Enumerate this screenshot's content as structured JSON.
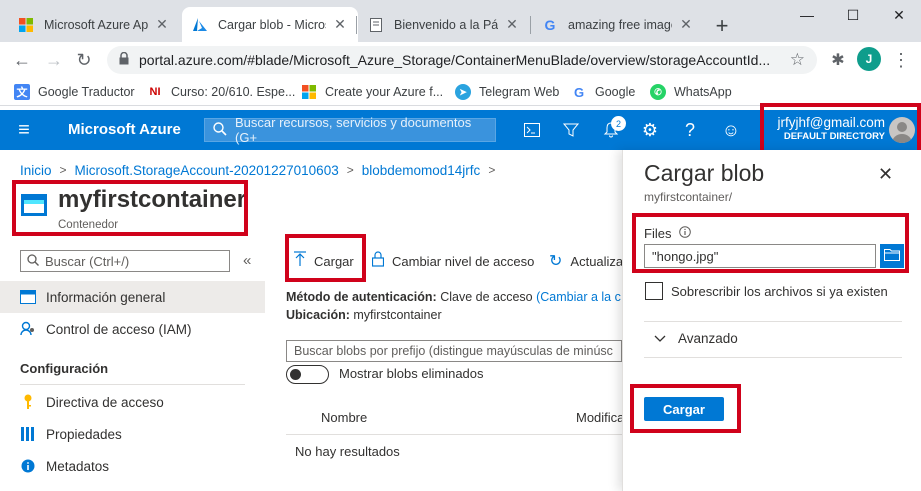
{
  "browser": {
    "tabs": [
      {
        "title": "Microsoft Azure App",
        "active": false
      },
      {
        "title": "Cargar blob - Micros",
        "active": true
      },
      {
        "title": "Bienvenido a la Pági",
        "active": false
      },
      {
        "title": "amazing free image",
        "active": false
      }
    ],
    "new_tab": "+",
    "url": "portal.azure.com/#blade/Microsoft_Azure_Storage/ContainerMenuBlade/overview/storageAccountId...",
    "profile_initial": "J",
    "bookmarks": [
      {
        "label": "Google Traductor",
        "icon": "google-translate-icon"
      },
      {
        "label": "Curso: 20/610. Espe...",
        "icon": "ni-icon"
      },
      {
        "label": "Create your Azure f...",
        "icon": "microsoft-icon"
      },
      {
        "label": "Telegram Web",
        "icon": "telegram-icon"
      },
      {
        "label": "Google",
        "icon": "google-icon"
      },
      {
        "label": "WhatsApp",
        "icon": "whatsapp-icon"
      }
    ]
  },
  "azure": {
    "brand": "Microsoft Azure",
    "search_placeholder": "Buscar recursos, servicios y documentos (G+",
    "notification_count": "2",
    "account_email": "jrfyjhf@gmail.com",
    "account_directory": "DEFAULT DIRECTORY"
  },
  "breadcrumb": [
    "Inicio",
    "Microsoft.StorageAccount-20201227010603",
    "blobdemomod14jrfc"
  ],
  "resource": {
    "title": "myfirstcontainer",
    "subtitle": "Contenedor"
  },
  "leftnav": {
    "search_placeholder": "Buscar (Ctrl+/)",
    "collapse": "«",
    "items": [
      {
        "label": "Información general",
        "icon": "overview-icon"
      },
      {
        "label": "Control de acceso (IAM)",
        "icon": "iam-icon"
      }
    ],
    "section": "Configuración",
    "config_items": [
      {
        "label": "Directiva de acceso",
        "icon": "key-icon"
      },
      {
        "label": "Propiedades",
        "icon": "properties-icon"
      },
      {
        "label": "Metadatos",
        "icon": "info-icon"
      }
    ]
  },
  "content": {
    "upload": "Cargar",
    "change_tier": "Cambiar nivel de acceso",
    "refresh": "Actualiza",
    "auth_label": "Método de autenticación:",
    "auth_value": "Clave de acceso",
    "auth_link": "(Cambiar a la c",
    "location_label": "Ubicación:",
    "location_value": "myfirstcontainer",
    "filter_placeholder": "Buscar blobs por prefijo (distingue mayúsculas de minúsc",
    "show_deleted": "Mostrar blobs eliminados",
    "col_name": "Nombre",
    "col_modified": "Modifica",
    "no_results": "No hay resultados"
  },
  "panel": {
    "title": "Cargar blob",
    "subtitle": "myfirstcontainer/",
    "files_label": "Files",
    "file_value": "\"hongo.jpg\"",
    "overwrite_label": "Sobrescribir los archivos si ya existen",
    "advanced": "Avanzado",
    "upload_button": "Cargar"
  },
  "colors": {
    "azure_blue": "#0078d4",
    "highlight_red": "#d0021b"
  }
}
